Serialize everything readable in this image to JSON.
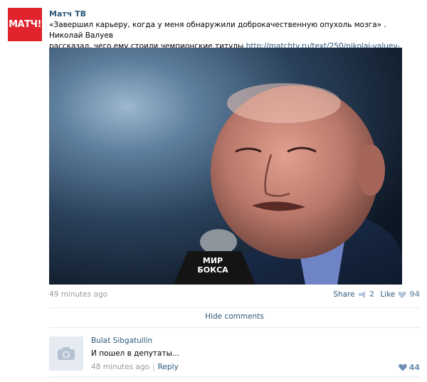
{
  "post": {
    "logo_text": "МАТЧ!",
    "author": "Матч ТВ",
    "text_line1": "«Завершил карьеру, когда у меня обнаружили доброкачественную опухоль мозга» . Николай Валуев",
    "text_line2": "рассказал, чего ему стоили чемпионские титулы ",
    "link": "http://matchtv.ru/text/250/nikolaj-valuev-zavershil-k..",
    "photo_mic_text1": "МИР",
    "photo_mic_text2": "БОКСА",
    "time": "49 minutes ago",
    "share_label": "Share",
    "share_count": "2",
    "like_label": "Like",
    "like_count": "94"
  },
  "comments_toggle": "Hide comments",
  "comment": {
    "author": "Bulat Sibgatullin",
    "text": "И пошел в депутаты...",
    "time": "48 minutes ago",
    "separator": "|",
    "reply_label": "Reply",
    "like_count": "44"
  },
  "colors": {
    "accent": "#2b587a",
    "logo": "#e0232d",
    "muted": "#999999",
    "like_icon": "#b5c7da"
  }
}
